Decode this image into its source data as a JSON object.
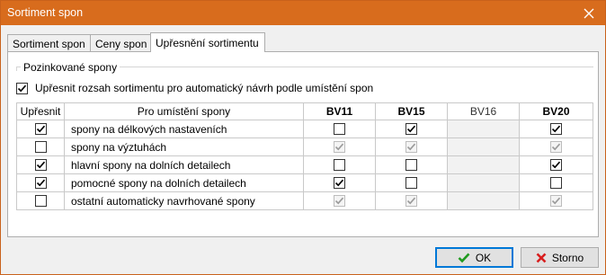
{
  "window": {
    "title": "Sortiment spon"
  },
  "tabs": [
    {
      "label": "Sortiment spon",
      "active": false
    },
    {
      "label": "Ceny spon",
      "active": false
    },
    {
      "label": "Upřesnění sortimentu",
      "active": true
    }
  ],
  "group": {
    "label": "Pozinkované spony",
    "refine_checkbox": {
      "label": "Upřesnit rozsah sortimentu pro automatický návrh podle umístění spon",
      "checked": true
    }
  },
  "table": {
    "headers": [
      "Upřesnit",
      "Pro umístění spony",
      "BV11",
      "BV15",
      "BV16",
      "BV20"
    ],
    "rows": [
      {
        "refine": true,
        "name": "spony na délkových nastaveních",
        "bv11": "unchecked",
        "bv15": "checked",
        "bv16": "none",
        "bv20": "checked"
      },
      {
        "refine": false,
        "name": "spony na výztuhách",
        "bv11": "disabled-checked",
        "bv15": "disabled-checked",
        "bv16": "none",
        "bv20": "disabled-checked"
      },
      {
        "refine": true,
        "name": "hlavní spony na dolních detailech",
        "bv11": "unchecked",
        "bv15": "unchecked",
        "bv16": "none",
        "bv20": "checked"
      },
      {
        "refine": true,
        "name": "pomocné spony na dolních detailech",
        "bv11": "checked",
        "bv15": "unchecked",
        "bv16": "none",
        "bv20": "unchecked"
      },
      {
        "refine": false,
        "name": "ostatní automaticky navrhované spony",
        "bv11": "disabled-checked",
        "bv15": "disabled-checked",
        "bv16": "none",
        "bv20": "disabled-checked"
      }
    ]
  },
  "buttons": {
    "ok": {
      "label": "OK",
      "icon": "check-icon"
    },
    "cancel": {
      "label": "Storno",
      "icon": "x-icon"
    }
  },
  "colors": {
    "titlebar": "#d86c1d",
    "ok_icon": "#1f9a1f",
    "cancel_icon": "#d81e1e",
    "focus_border": "#0078d7"
  }
}
